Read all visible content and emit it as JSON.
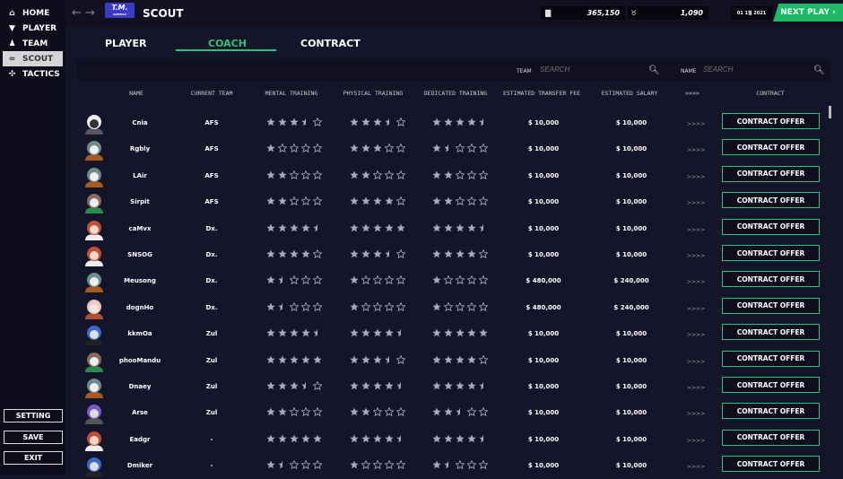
{
  "sidebar": {
    "items": [
      {
        "label": "HOME",
        "icon": "home-icon"
      },
      {
        "label": "PLAYER",
        "icon": "shirt-icon"
      },
      {
        "label": "TEAM",
        "icon": "team-icon"
      },
      {
        "label": "SCOUT",
        "icon": "binoculars-icon",
        "active": true
      },
      {
        "label": "TACTICS",
        "icon": "tactics-icon"
      }
    ],
    "setting": "SETTING",
    "save": "SAVE",
    "exit": "EXIT"
  },
  "header": {
    "logo": "T.M.",
    "logo_sub": "AMERICA",
    "title": "SCOUT",
    "money": "365,150",
    "trophies": "1,090",
    "date": "01 1월 2021",
    "next_play": "NEXT PLAY"
  },
  "tabs": [
    {
      "label": "PLAYER"
    },
    {
      "label": "COACH",
      "active": true
    },
    {
      "label": "CONTRACT"
    }
  ],
  "search": {
    "team_label": "TEAM",
    "team_placeholder": "SEARCH",
    "name_label": "NAME",
    "name_placeholder": "SEARCH"
  },
  "columns": [
    "NAME",
    "CURRENT TEAM",
    "MENTAL TRAINING",
    "PHYSICAL TRAINING",
    "DEDICATED TRAINING",
    "ESTIMATED TRANSFER FEE",
    "ESTIMATED SALARY",
    ">>>>",
    "CONTRACT"
  ],
  "colors": {
    "accent": "#2ec27e",
    "background": "#15152a",
    "star": "#a9abbb"
  },
  "rows": [
    {
      "name": "Cnia",
      "team": "AFS",
      "mental": 3.5,
      "physical": 3.5,
      "dedicated": 4.5,
      "fee": "$ 10,000",
      "salary": "$ 10,000"
    },
    {
      "name": "Rgbly",
      "team": "AFS",
      "mental": 1,
      "physical": 3,
      "dedicated": 1.5,
      "fee": "$ 10,000",
      "salary": "$ 10,000"
    },
    {
      "name": "LAir",
      "team": "AFS",
      "mental": 2,
      "physical": 2,
      "dedicated": 2,
      "fee": "$ 10,000",
      "salary": "$ 10,000"
    },
    {
      "name": "Sirpit",
      "team": "AFS",
      "mental": 2,
      "physical": 4,
      "dedicated": 2,
      "fee": "$ 10,000",
      "salary": "$ 10,000"
    },
    {
      "name": "caMvx",
      "team": "Dx.",
      "mental": 4.5,
      "physical": 5,
      "dedicated": 4.5,
      "fee": "$ 10,000",
      "salary": "$ 10,000"
    },
    {
      "name": "SNSOG",
      "team": "Dx.",
      "mental": 4,
      "physical": 3.5,
      "dedicated": 4,
      "fee": "$ 10,000",
      "salary": "$ 10,000"
    },
    {
      "name": "Meusong",
      "team": "Dx.",
      "mental": 1.5,
      "physical": 1,
      "dedicated": 1,
      "fee": "$ 480,000",
      "salary": "$ 240,000"
    },
    {
      "name": "dognHo",
      "team": "Dx.",
      "mental": 1.5,
      "physical": 1,
      "dedicated": 1,
      "fee": "$ 480,000",
      "salary": "$ 240,000"
    },
    {
      "name": "kkmOa",
      "team": "Zul",
      "mental": 4.5,
      "physical": 4.5,
      "dedicated": 5,
      "fee": "$ 10,000",
      "salary": "$ 10,000"
    },
    {
      "name": "phooMandu",
      "team": "Zul",
      "mental": 5,
      "physical": 3.5,
      "dedicated": 4,
      "fee": "$ 10,000",
      "salary": "$ 10,000"
    },
    {
      "name": "Dnaey",
      "team": "Zul",
      "mental": 3.5,
      "physical": 4.5,
      "dedicated": 4.5,
      "fee": "$ 10,000",
      "salary": "$ 10,000"
    },
    {
      "name": "Arse",
      "team": "Zul",
      "mental": 2,
      "physical": 2,
      "dedicated": 2.5,
      "fee": "$ 10,000",
      "salary": "$ 10,000"
    },
    {
      "name": "Eadgr",
      "team": "-",
      "mental": 5,
      "physical": 4.5,
      "dedicated": 4.5,
      "fee": "$ 10,000",
      "salary": "$ 10,000"
    },
    {
      "name": "Dmiker",
      "team": "-",
      "mental": 1.5,
      "physical": 1,
      "dedicated": 1.5,
      "fee": "$ 10,000",
      "salary": "$ 10,000"
    }
  ],
  "row_more": ">>>>",
  "contract_button": "CONTRACT OFFER"
}
